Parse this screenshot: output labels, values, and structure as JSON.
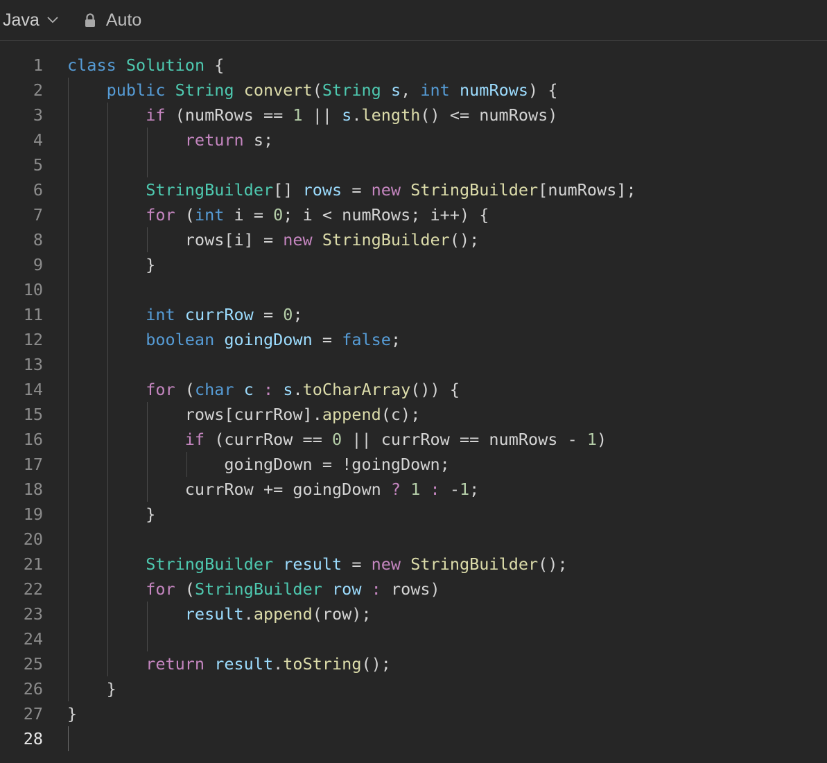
{
  "toolbar": {
    "language": "Java",
    "mode": "Auto",
    "icons": {
      "dropdown": "chevron-down-icon",
      "lock": "lock-icon"
    }
  },
  "colors": {
    "background": "#262626",
    "keyword": "#569cd6",
    "control": "#c586c0",
    "type": "#4ec9b0",
    "function": "#dcdcaa",
    "variable": "#9cdcfe",
    "number": "#b5cea8",
    "text": "#d4d4d4"
  },
  "editor": {
    "active_line": 28,
    "lines": [
      {
        "num": "1",
        "tokens": [
          [
            "kw",
            "class"
          ],
          [
            "plain",
            " "
          ],
          [
            "type",
            "Solution"
          ],
          [
            "plain",
            " {"
          ]
        ]
      },
      {
        "num": "2",
        "tokens": [
          [
            "plain",
            "    "
          ],
          [
            "kw",
            "public"
          ],
          [
            "plain",
            " "
          ],
          [
            "type",
            "String"
          ],
          [
            "plain",
            " "
          ],
          [
            "fn",
            "convert"
          ],
          [
            "plain",
            "("
          ],
          [
            "type",
            "String"
          ],
          [
            "plain",
            " "
          ],
          [
            "var",
            "s"
          ],
          [
            "plain",
            ", "
          ],
          [
            "kw",
            "int"
          ],
          [
            "plain",
            " "
          ],
          [
            "var",
            "numRows"
          ],
          [
            "plain",
            ") {"
          ]
        ]
      },
      {
        "num": "3",
        "tokens": [
          [
            "plain",
            "        "
          ],
          [
            "ctl",
            "if"
          ],
          [
            "plain",
            " (numRows == "
          ],
          [
            "num",
            "1"
          ],
          [
            "plain",
            " || "
          ],
          [
            "var",
            "s"
          ],
          [
            "plain",
            "."
          ],
          [
            "fn",
            "length"
          ],
          [
            "plain",
            "() <= numRows)"
          ]
        ]
      },
      {
        "num": "4",
        "tokens": [
          [
            "plain",
            "            "
          ],
          [
            "ctl",
            "return"
          ],
          [
            "plain",
            " s;"
          ]
        ]
      },
      {
        "num": "5",
        "tokens": []
      },
      {
        "num": "6",
        "tokens": [
          [
            "plain",
            "        "
          ],
          [
            "type",
            "StringBuilder"
          ],
          [
            "plain",
            "[] "
          ],
          [
            "var",
            "rows"
          ],
          [
            "plain",
            " = "
          ],
          [
            "ctl",
            "new"
          ],
          [
            "plain",
            " "
          ],
          [
            "fn",
            "StringBuilder"
          ],
          [
            "plain",
            "[numRows];"
          ]
        ]
      },
      {
        "num": "7",
        "tokens": [
          [
            "plain",
            "        "
          ],
          [
            "ctl",
            "for"
          ],
          [
            "plain",
            " ("
          ],
          [
            "kw",
            "int"
          ],
          [
            "plain",
            " i = "
          ],
          [
            "num",
            "0"
          ],
          [
            "plain",
            "; i < numRows; i++) {"
          ]
        ]
      },
      {
        "num": "8",
        "tokens": [
          [
            "plain",
            "            rows[i] = "
          ],
          [
            "ctl",
            "new"
          ],
          [
            "plain",
            " "
          ],
          [
            "fn",
            "StringBuilder"
          ],
          [
            "plain",
            "();"
          ]
        ]
      },
      {
        "num": "9",
        "tokens": [
          [
            "plain",
            "        }"
          ]
        ]
      },
      {
        "num": "10",
        "tokens": []
      },
      {
        "num": "11",
        "tokens": [
          [
            "plain",
            "        "
          ],
          [
            "kw",
            "int"
          ],
          [
            "plain",
            " "
          ],
          [
            "var",
            "currRow"
          ],
          [
            "plain",
            " = "
          ],
          [
            "num",
            "0"
          ],
          [
            "plain",
            ";"
          ]
        ]
      },
      {
        "num": "12",
        "tokens": [
          [
            "plain",
            "        "
          ],
          [
            "kw",
            "boolean"
          ],
          [
            "plain",
            " "
          ],
          [
            "var",
            "goingDown"
          ],
          [
            "plain",
            " = "
          ],
          [
            "kw",
            "false"
          ],
          [
            "plain",
            ";"
          ]
        ]
      },
      {
        "num": "13",
        "tokens": []
      },
      {
        "num": "14",
        "tokens": [
          [
            "plain",
            "        "
          ],
          [
            "ctl",
            "for"
          ],
          [
            "plain",
            " ("
          ],
          [
            "kw",
            "char"
          ],
          [
            "plain",
            " "
          ],
          [
            "var",
            "c"
          ],
          [
            "plain",
            " "
          ],
          [
            "ctl",
            ":"
          ],
          [
            "plain",
            " "
          ],
          [
            "var",
            "s"
          ],
          [
            "plain",
            "."
          ],
          [
            "fn",
            "toCharArray"
          ],
          [
            "plain",
            "()) {"
          ]
        ]
      },
      {
        "num": "15",
        "tokens": [
          [
            "plain",
            "            rows[currRow]."
          ],
          [
            "fn",
            "append"
          ],
          [
            "plain",
            "(c);"
          ]
        ]
      },
      {
        "num": "16",
        "tokens": [
          [
            "plain",
            "            "
          ],
          [
            "ctl",
            "if"
          ],
          [
            "plain",
            " (currRow == "
          ],
          [
            "num",
            "0"
          ],
          [
            "plain",
            " || currRow == numRows - "
          ],
          [
            "num",
            "1"
          ],
          [
            "plain",
            ")"
          ]
        ]
      },
      {
        "num": "17",
        "tokens": [
          [
            "plain",
            "                goingDown = !goingDown;"
          ]
        ]
      },
      {
        "num": "18",
        "tokens": [
          [
            "plain",
            "            currRow += goingDown "
          ],
          [
            "ctl",
            "?"
          ],
          [
            "plain",
            " "
          ],
          [
            "num",
            "1"
          ],
          [
            "plain",
            " "
          ],
          [
            "ctl",
            ":"
          ],
          [
            "plain",
            " -"
          ],
          [
            "num",
            "1"
          ],
          [
            "plain",
            ";"
          ]
        ]
      },
      {
        "num": "19",
        "tokens": [
          [
            "plain",
            "        }"
          ]
        ]
      },
      {
        "num": "20",
        "tokens": []
      },
      {
        "num": "21",
        "tokens": [
          [
            "plain",
            "        "
          ],
          [
            "type",
            "StringBuilder"
          ],
          [
            "plain",
            " "
          ],
          [
            "var",
            "result"
          ],
          [
            "plain",
            " = "
          ],
          [
            "ctl",
            "new"
          ],
          [
            "plain",
            " "
          ],
          [
            "fn",
            "StringBuilder"
          ],
          [
            "plain",
            "();"
          ]
        ]
      },
      {
        "num": "22",
        "tokens": [
          [
            "plain",
            "        "
          ],
          [
            "ctl",
            "for"
          ],
          [
            "plain",
            " ("
          ],
          [
            "type",
            "StringBuilder"
          ],
          [
            "plain",
            " "
          ],
          [
            "var",
            "row"
          ],
          [
            "plain",
            " "
          ],
          [
            "ctl",
            ":"
          ],
          [
            "plain",
            " rows)"
          ]
        ]
      },
      {
        "num": "23",
        "tokens": [
          [
            "plain",
            "            "
          ],
          [
            "var",
            "result"
          ],
          [
            "plain",
            "."
          ],
          [
            "fn",
            "append"
          ],
          [
            "plain",
            "(row);"
          ]
        ]
      },
      {
        "num": "24",
        "tokens": []
      },
      {
        "num": "25",
        "tokens": [
          [
            "plain",
            "        "
          ],
          [
            "ctl",
            "return"
          ],
          [
            "plain",
            " "
          ],
          [
            "var",
            "result"
          ],
          [
            "plain",
            "."
          ],
          [
            "fn",
            "toString"
          ],
          [
            "plain",
            "();"
          ]
        ]
      },
      {
        "num": "26",
        "tokens": [
          [
            "plain",
            "    }"
          ]
        ]
      },
      {
        "num": "27",
        "tokens": [
          [
            "plain",
            "}"
          ]
        ]
      },
      {
        "num": "28",
        "tokens": []
      }
    ]
  }
}
